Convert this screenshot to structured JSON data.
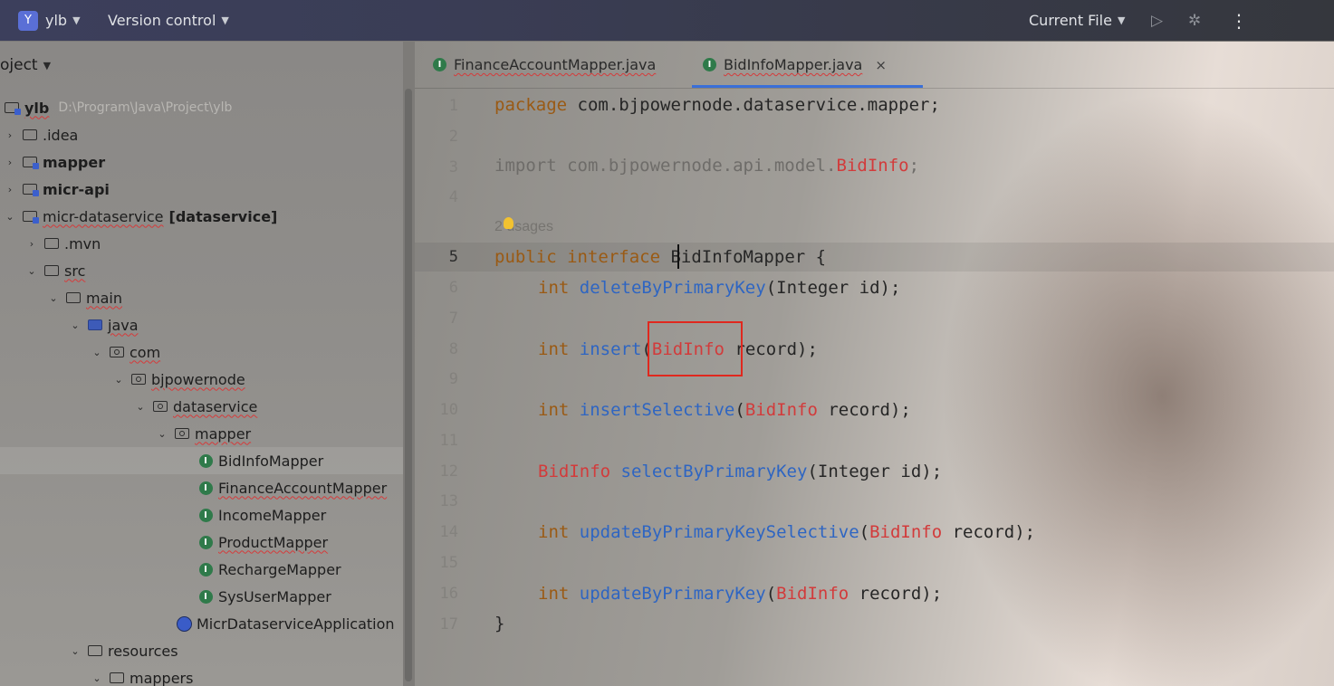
{
  "titlebar": {
    "project_badge": "Y",
    "project_name": "ylb",
    "vcs_label": "Version control",
    "run_config": "Current File",
    "icons": [
      "chevron-down-icon",
      "run-icon",
      "debug-icon",
      "more-vertical-icon"
    ]
  },
  "project_panel": {
    "header": "oject",
    "tree": [
      {
        "label": "ylb",
        "extra": "D:\\Program\\Java\\Project\\ylb"
      },
      {
        "label": ".idea"
      },
      {
        "label": "mapper"
      },
      {
        "label": "micr-api"
      },
      {
        "label": "micr-dataservice",
        "module": "[dataservice]"
      },
      {
        "label": ".mvn"
      },
      {
        "label": "src"
      },
      {
        "label": "main"
      },
      {
        "label": "java"
      },
      {
        "label": "com"
      },
      {
        "label": "bjpowernode"
      },
      {
        "label": "dataservice"
      },
      {
        "label": "mapper"
      },
      {
        "label": "BidInfoMapper"
      },
      {
        "label": "FinanceAccountMapper"
      },
      {
        "label": "IncomeMapper"
      },
      {
        "label": "ProductMapper"
      },
      {
        "label": "RechargeMapper"
      },
      {
        "label": "SysUserMapper"
      },
      {
        "label": "MicrDataserviceApplication"
      },
      {
        "label": "resources"
      },
      {
        "label": "mappers"
      }
    ]
  },
  "editor": {
    "tabs": [
      {
        "label": "FinanceAccountMapper.java",
        "active": false
      },
      {
        "label": "BidInfoMapper.java",
        "active": true
      }
    ],
    "close_glyph": "×",
    "line_numbers": [
      "1",
      "2",
      "3",
      "4",
      "",
      "5",
      "6",
      "7",
      "8",
      "9",
      "10",
      "11",
      "12",
      "13",
      "14",
      "15",
      "16",
      "17"
    ],
    "current_line": "5",
    "usages_hint": "2 usages",
    "code": {
      "l1_kw": "package",
      "l1_rest": " com.bjpowernode.dataservice.mapper;",
      "l3_kw": "import",
      "l3_pkg": " com.bjpowernode.api.model.",
      "l3_cls": "BidInfo",
      "l3_end": ";",
      "l5_kw1": "public",
      "l5_kw2": " interface ",
      "l5_name": "BidInfoMapper",
      "l5_end": " {",
      "l6_type": "int",
      "l6_fn": "deleteByPrimaryKey",
      "l6_rest": "(Integer id);",
      "l8_type": "int",
      "l8_fn": "insert",
      "l8_open": "(",
      "l8_cls": "BidInfo",
      "l8_rest": " record);",
      "l10_type": "int",
      "l10_fn": "insertSelective",
      "l10_open": "(",
      "l10_cls": "BidInfo",
      "l10_rest": " record);",
      "l12_cls": "BidInfo",
      "l12_fn": "selectByPrimaryKey",
      "l12_rest": "(Integer id);",
      "l14_type": "int",
      "l14_fn": "updateByPrimaryKeySelective",
      "l14_open": "(",
      "l14_cls": "BidInfo",
      "l14_rest": " record);",
      "l16_type": "int",
      "l16_fn": "updateByPrimaryKey",
      "l16_open": "(",
      "l16_cls": "BidInfo",
      "l16_rest": " record);",
      "l17": "}"
    },
    "colors": {
      "keyword": "#9a5a14",
      "function": "#2e65c2",
      "class_error": "#d23b3b",
      "highlight_box": "#e0281e"
    }
  }
}
